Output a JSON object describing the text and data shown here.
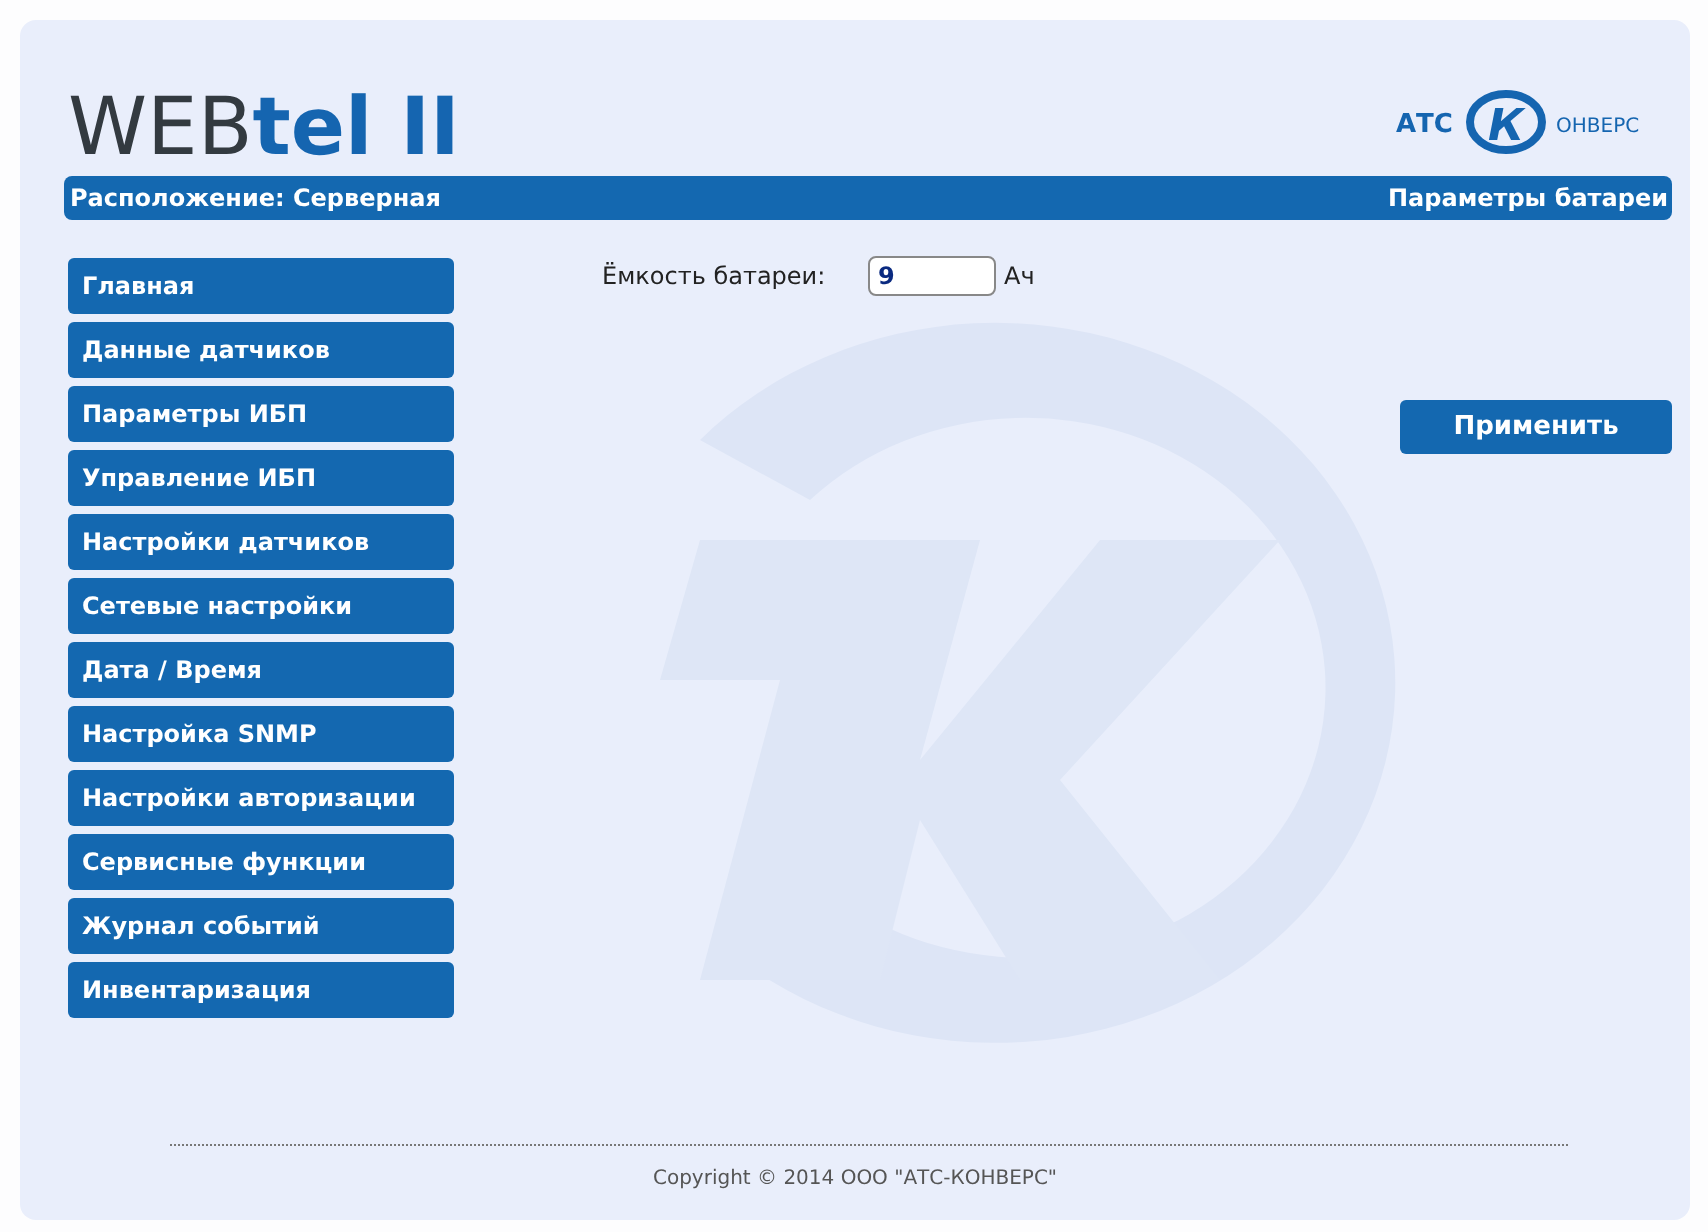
{
  "logo": {
    "main": "WEB",
    "accent": "tel II"
  },
  "brand_logo": {
    "left": "АТС",
    "mark": "К",
    "right": "ОНВЕРС"
  },
  "header": {
    "location": "Расположение: Серверная",
    "page_title": "Параметры батареи"
  },
  "menu": [
    {
      "label": "Главная"
    },
    {
      "label": "Данные датчиков"
    },
    {
      "label": "Параметры ИБП"
    },
    {
      "label": "Управление ИБП"
    },
    {
      "label": "Настройки датчиков"
    },
    {
      "label": "Сетевые настройки"
    },
    {
      "label": "Дата / Время"
    },
    {
      "label": "Настройка SNMP"
    },
    {
      "label": "Настройки авторизации"
    },
    {
      "label": "Сервисные функции"
    },
    {
      "label": "Журнал событий"
    },
    {
      "label": "Инвентаризация"
    }
  ],
  "form": {
    "label": "Ёмкость батареи:",
    "value": "9",
    "unit": "Ач",
    "apply_button": "Применить"
  },
  "footer": "Copyright © 2014 ООО \"АТС-КОНВЕРС\""
}
